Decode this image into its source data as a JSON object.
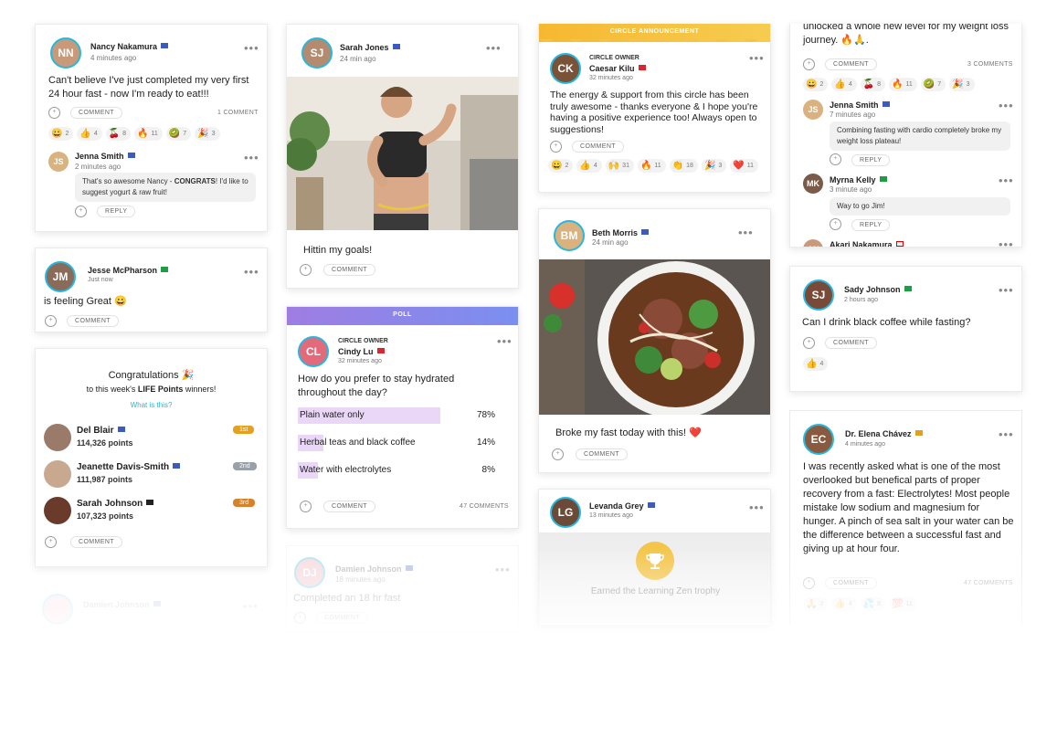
{
  "labels": {
    "comment": "COMMENT",
    "reply": "REPLY"
  },
  "nancy": {
    "name": "Nancy Nakamura",
    "time": "4 minutes ago",
    "text": "Can't believe I've just completed my very first 24 hour fast - now I'm ready to eat!!!",
    "count": "1 COMMENT",
    "reactions": [
      {
        "e": "😀",
        "n": "2"
      },
      {
        "e": "👍",
        "n": "4"
      },
      {
        "e": "🍒",
        "n": "8"
      },
      {
        "e": "🔥",
        "n": "11"
      },
      {
        "e": "🥝",
        "n": "7"
      },
      {
        "e": "🎉",
        "n": "3"
      }
    ],
    "reply": {
      "name": "Jenna Smith",
      "time": "2 minutes ago",
      "text_before": "That's so awesome Nancy - ",
      "text_bold": "CONGRATS",
      "text_after": "! I'd like to suggest yogurt & raw fruit!"
    }
  },
  "jesse": {
    "name": "Jesse McPharson",
    "time": "Just now",
    "text": "is feeling Great 😀"
  },
  "leader": {
    "title": "Congratulations 🎉",
    "subtitle_pre": "to this week's ",
    "subtitle_bold": "LIFE Points",
    "subtitle_post": " winners!",
    "link": "What is this?",
    "rows": [
      {
        "name": "Del Blair",
        "points": "114,326 points",
        "rank": "1st",
        "color": "#e5a020"
      },
      {
        "name": "Jeanette Davis-Smith",
        "points": "111,987 points",
        "rank": "2nd",
        "color": "#9aa0a8"
      },
      {
        "name": "Sarah Johnson",
        "points": "107,323 points",
        "rank": "3rd",
        "color": "#d7822a"
      }
    ]
  },
  "damienFaded": {
    "name": "Damien Johnson"
  },
  "sarah": {
    "name": "Sarah Jones",
    "time": "24 min ago",
    "text": "Hittin my goals!"
  },
  "poll": {
    "banner": "POLL",
    "owner": "CIRCLE OWNER",
    "name": "Cindy Lu",
    "time": "32 minutes ago",
    "question": "How do you prefer to stay hydrated throughout the day?",
    "count": "47 COMMENTS",
    "options": [
      {
        "label": "Plain water only",
        "pct": "78%",
        "frac": 0.78
      },
      {
        "label": "Herbal teas and black coffee",
        "pct": "14%",
        "frac": 0.14
      },
      {
        "label": "Water with electrolytes",
        "pct": "8%",
        "frac": 0.08
      }
    ]
  },
  "damien": {
    "name": "Damien Johnson",
    "time": "18 minutes ago",
    "text": "Completed an 18 hr fast"
  },
  "announce": {
    "banner": "CIRCLE ANNOUNCEMENT",
    "owner": "CIRCLE OWNER",
    "name": "Caesar Kilu",
    "time": "32 minutes ago",
    "text": "The energy & support from this circle has been truly awesome - thanks everyone & I hope you're having a positive experience too! Always open to suggestions!",
    "reactions": [
      {
        "e": "😀",
        "n": "2"
      },
      {
        "e": "👍",
        "n": "4"
      },
      {
        "e": "🙌",
        "n": "31"
      },
      {
        "e": "🔥",
        "n": "11"
      },
      {
        "e": "👏",
        "n": "18"
      },
      {
        "e": "🎉",
        "n": "3"
      },
      {
        "e": "❤️",
        "n": "11"
      }
    ]
  },
  "beth": {
    "name": "Beth Morris",
    "time": "24 min ago",
    "text": "Broke my fast today with this! ❤️"
  },
  "levanda": {
    "name": "Levanda Grey",
    "time": "13 minutes ago",
    "trophy": "Earned the Learning Zen trophy"
  },
  "jim": {
    "text": "unlocked a whole new level for my weight loss journey. 🔥🙏.",
    "count": "3 COMMENTS",
    "reactions": [
      {
        "e": "😀",
        "n": "2"
      },
      {
        "e": "👍",
        "n": "4"
      },
      {
        "e": "🍒",
        "n": "8"
      },
      {
        "e": "🔥",
        "n": "11"
      },
      {
        "e": "🥝",
        "n": "7"
      },
      {
        "e": "🎉",
        "n": "3"
      }
    ],
    "replies": [
      {
        "name": "Jenna Smith",
        "time": "7 minutes ago",
        "text": "Combining fasting with cardio completely broke my weight loss plateau!"
      },
      {
        "name": "Myrna Kelly",
        "time": "3 minute ago",
        "text": "Way to go Jim!"
      }
    ],
    "cut": "Akari Nakamura"
  },
  "sady": {
    "name": "Sady Johnson",
    "time": "2 hours ago",
    "text": "Can I drink black coffee while fasting?",
    "reactions": [
      {
        "e": "👍",
        "n": "4"
      }
    ]
  },
  "elena": {
    "name": "Dr. Elena Chávez",
    "time": "4 minutes ago",
    "text": "I was recently asked what is one of the most overlooked but benefical parts of proper recovery from a fast: Electrolytes! Most people mistake low sodium and magnesium for hunger. A pinch of sea salt in your water can be the difference between a successful fast and giving up at hour four.",
    "count": "47 COMMENTS",
    "reactions": [
      {
        "e": "🙏",
        "n": "2"
      },
      {
        "e": "👍",
        "n": "4"
      },
      {
        "e": "💦",
        "n": "8"
      },
      {
        "e": "💯",
        "n": "11"
      }
    ]
  }
}
